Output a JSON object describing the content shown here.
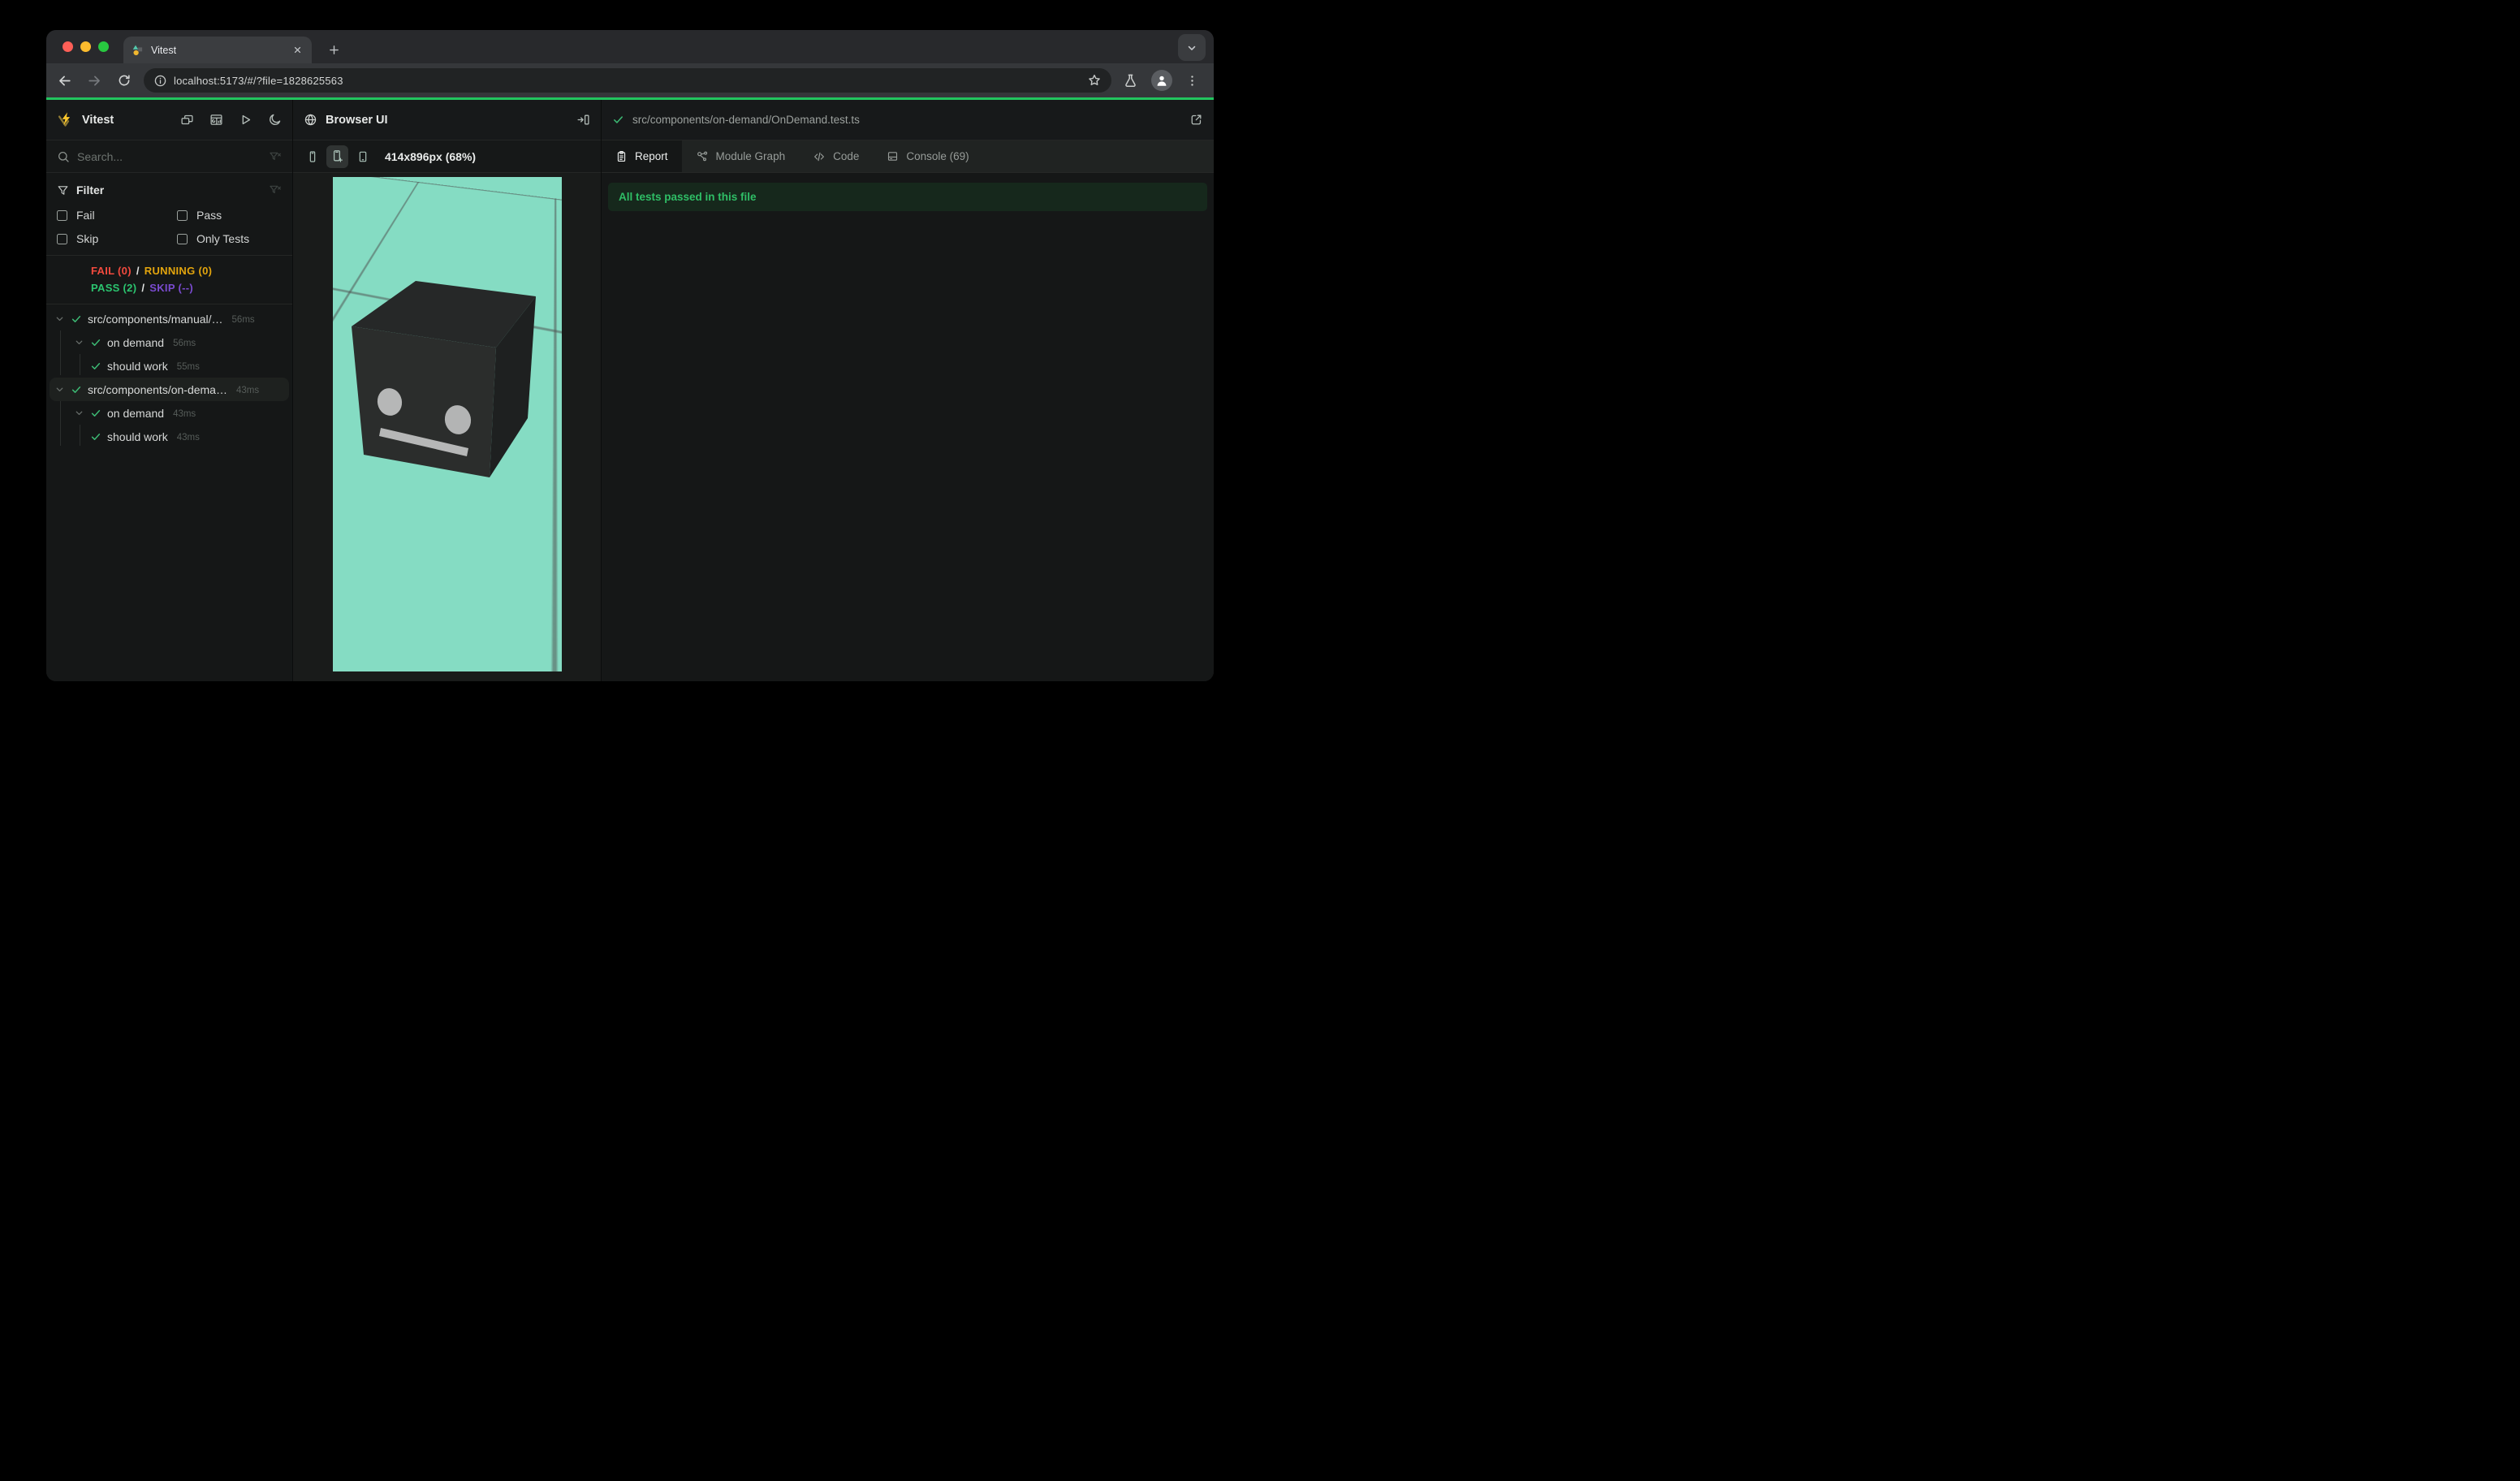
{
  "browser_chrome": {
    "tab_title": "Vitest",
    "url": "localhost:5173/#/?file=1828625563",
    "traffic_lights": [
      "close",
      "minimize",
      "zoom"
    ],
    "toolbar_icons": [
      "back-icon",
      "forward-icon",
      "reload-icon",
      "info-icon",
      "star-icon",
      "flask-icon",
      "profile-icon",
      "menu-icon"
    ]
  },
  "sidebar": {
    "app_title": "Vitest",
    "header_icons": [
      "windows-icon",
      "dashboard-icon",
      "run-all-icon",
      "dark-mode-icon"
    ],
    "search": {
      "placeholder": "Search...",
      "clear_icon": "filter-x-icon"
    },
    "filter": {
      "title": "Filter",
      "options": [
        {
          "label": "Fail",
          "checked": false
        },
        {
          "label": "Pass",
          "checked": false
        },
        {
          "label": "Skip",
          "checked": false
        },
        {
          "label": "Only Tests",
          "checked": false
        }
      ]
    },
    "summary": {
      "fail": "FAIL (0)",
      "running": "RUNNING (0)",
      "pass": "PASS (2)",
      "skip": "SKIP (--)",
      "separator": "/"
    },
    "tree": [
      {
        "label": "src/components/manual/…",
        "duration": "56ms",
        "status": "pass"
      },
      {
        "label": "on demand",
        "duration": "56ms",
        "status": "pass"
      },
      {
        "label": "should work",
        "duration": "55ms",
        "status": "pass"
      },
      {
        "label": "src/components/on-dema…",
        "duration": "43ms",
        "status": "pass"
      },
      {
        "label": "on demand",
        "duration": "43ms",
        "status": "pass"
      },
      {
        "label": "should work",
        "duration": "43ms",
        "status": "pass"
      }
    ]
  },
  "browser_panel": {
    "title": "Browser UI",
    "viewport_label": "414x896px (68%)",
    "device_icons": [
      "phone-narrow-icon",
      "phone-add-icon",
      "tablet-icon"
    ],
    "scene": "3d cube robot head on mint grid floor"
  },
  "report_panel": {
    "file_path": "src/components/on-demand/OnDemand.test.ts",
    "tabs": [
      {
        "label": "Report",
        "active": true
      },
      {
        "label": "Module Graph",
        "active": false
      },
      {
        "label": "Code",
        "active": false
      },
      {
        "label": "Console (69)",
        "active": false
      }
    ],
    "banner": "All tests passed in this file"
  },
  "colors": {
    "accent_green": "#22c55e",
    "pass_green": "#2bc46f",
    "fail_red": "#f24a3e",
    "running_yellow": "#e3a50d",
    "skip_purple": "#7a4bd0",
    "viewport_bg": "#85dcc3",
    "banner_bg": "#16281c",
    "vitest_yellow": "#fcc72b"
  }
}
